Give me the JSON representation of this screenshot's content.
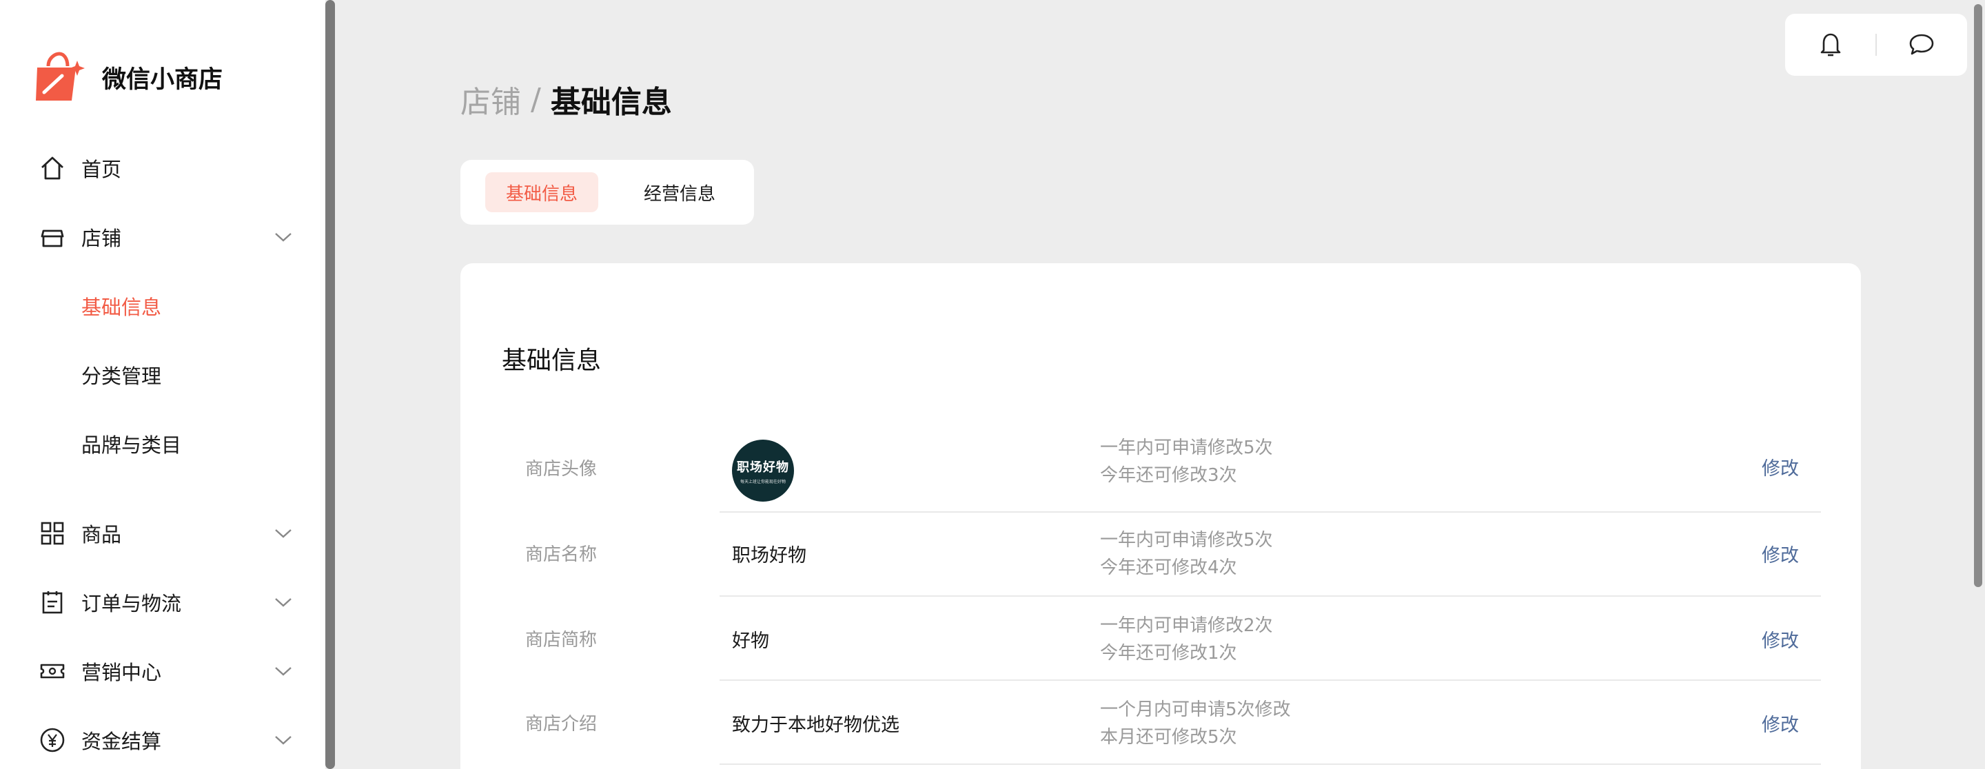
{
  "brand": {
    "name": "微信小商店",
    "accent": "#f25b45"
  },
  "nav": {
    "home": {
      "label": "首页",
      "icon": "home-icon"
    },
    "store": {
      "label": "店铺",
      "icon": "store-icon",
      "children": [
        {
          "label": "基础信息",
          "active": true
        },
        {
          "label": "分类管理",
          "active": false
        },
        {
          "label": "品牌与类目",
          "active": false
        }
      ]
    },
    "products": {
      "label": "商品",
      "icon": "grid-icon"
    },
    "orders": {
      "label": "订单与物流",
      "icon": "clipboard-icon"
    },
    "marketing": {
      "label": "营销中心",
      "icon": "ticket-icon"
    },
    "finance": {
      "label": "资金结算",
      "icon": "yuan-icon"
    }
  },
  "header": {
    "icons": [
      "bell-icon",
      "chat-icon"
    ]
  },
  "breadcrumb": {
    "parent": "店铺",
    "separator": "/",
    "current": "基础信息"
  },
  "tabs": [
    {
      "label": "基础信息",
      "active": true
    },
    {
      "label": "经营信息",
      "active": false
    }
  ],
  "card": {
    "title": "基础信息",
    "rows": [
      {
        "label": "商店头像",
        "avatar_text": "职场好物",
        "avatar_sub": "每天上班让你能现在好物",
        "note_line1": "一年内可申请修改5次",
        "note_line2": "今年还可修改3次",
        "action": "修改"
      },
      {
        "label": "商店名称",
        "value": "职场好物",
        "note_line1": "一年内可申请修改5次",
        "note_line2": "今年还可修改4次",
        "action": "修改"
      },
      {
        "label": "商店简称",
        "value": "好物",
        "note_line1": "一年内可申请修改2次",
        "note_line2": "今年还可修改1次",
        "action": "修改"
      },
      {
        "label": "商店介绍",
        "value": "致力于本地好物优选",
        "note_line1": "一个月内可申请5次修改",
        "note_line2": "本月还可修改5次",
        "action": "修改"
      }
    ]
  }
}
